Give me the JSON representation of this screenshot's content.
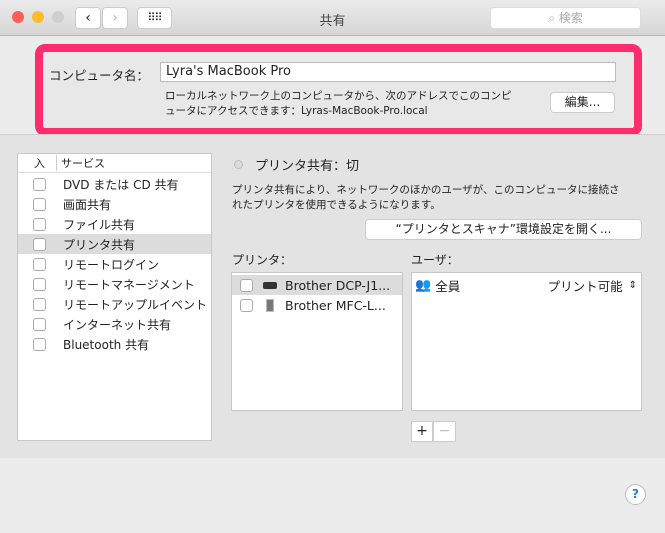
{
  "window": {
    "title": "共有",
    "search_placeholder": "検索"
  },
  "computer_name": {
    "label": "コンピュータ名：",
    "value": "Lyra's MacBook Pro",
    "desc_line1": "ローカルネットワーク上のコンピュータから、次のアドレスでこのコンピ",
    "desc_line2": "ュータにアクセスできます：Lyras-MacBook-Pro.local",
    "edit_button": "編集..."
  },
  "services": {
    "header_on": "入",
    "header_service": "サービス",
    "items": [
      {
        "label": "DVD または CD 共有",
        "checked": false
      },
      {
        "label": "画面共有",
        "checked": false
      },
      {
        "label": "ファイル共有",
        "checked": false
      },
      {
        "label": "プリンタ共有",
        "checked": false,
        "selected": true
      },
      {
        "label": "リモートログイン",
        "checked": false
      },
      {
        "label": "リモートマネージメント",
        "checked": false
      },
      {
        "label": "リモートアップルイベント",
        "checked": false
      },
      {
        "label": "インターネット共有",
        "checked": false
      },
      {
        "label": "Bluetooth 共有",
        "checked": false
      }
    ]
  },
  "detail": {
    "status": "プリンタ共有：切",
    "desc_line1": "プリンタ共有により、ネットワークのほかのユーザが、このコンピュータに接続さ",
    "desc_line2": "れたプリンタを使用できるようになります。",
    "open_prefs_button": "“プリンタとスキャナ”環境設定を開く...",
    "printers_label": "プリンタ：",
    "users_label": "ユーザ：",
    "printers": [
      {
        "name": "Brother DCP-J1..."
      },
      {
        "name": "Brother MFC-L..."
      }
    ],
    "users": [
      {
        "name": "全員",
        "permission": "プリント可能"
      }
    ],
    "add": "+",
    "remove": "−"
  },
  "help": "?"
}
